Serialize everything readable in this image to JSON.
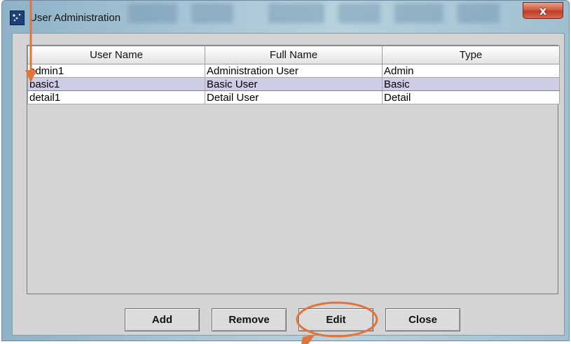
{
  "window": {
    "title": "User Administration",
    "close_glyph": "x"
  },
  "table": {
    "columns": [
      "User Name",
      "Full Name",
      "Type"
    ],
    "rows": [
      {
        "user_name": "admin1",
        "full_name": "Administration User",
        "type": "Admin",
        "selected": false
      },
      {
        "user_name": "basic1",
        "full_name": "Basic User",
        "type": "Basic",
        "selected": true
      },
      {
        "user_name": "detail1",
        "full_name": "Detail User",
        "type": "Detail",
        "selected": false
      }
    ]
  },
  "buttons": {
    "add": "Add",
    "remove": "Remove",
    "edit": "Edit",
    "close": "Close"
  },
  "annotation": {
    "color": "#e2743a",
    "highlighted_button": "Edit"
  },
  "colors": {
    "selection": "#cdcde6",
    "panel": "#d4d4d4"
  }
}
